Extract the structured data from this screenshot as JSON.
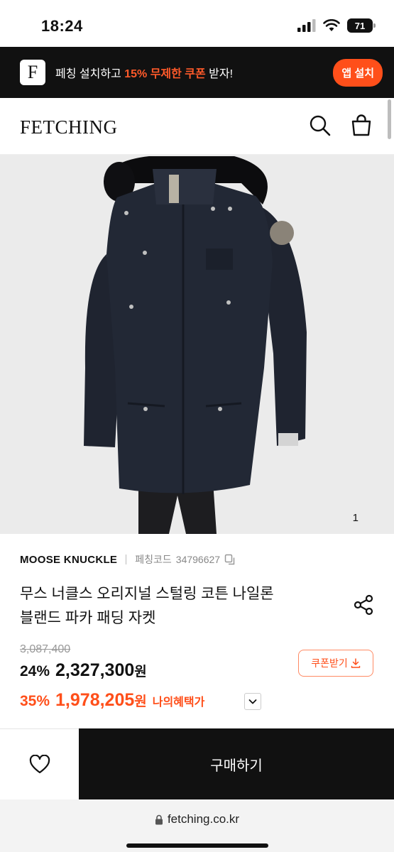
{
  "status_bar": {
    "time": "18:24",
    "battery": "71"
  },
  "app_banner": {
    "logo": "F",
    "text_prefix": "페칭 설치하고 ",
    "text_highlight": "15% 무제한 쿠폰",
    "text_suffix": " 받자!",
    "install_label": "앱 설치",
    "accent_color": "#ff4f1a"
  },
  "header": {
    "wordmark": "FETCHING",
    "icons": [
      "search-icon",
      "shopping-bag-icon"
    ]
  },
  "gallery": {
    "counter": "1"
  },
  "product": {
    "brand": "MOOSE KNUCKLE",
    "code_label": "페칭코드",
    "code": "34796627",
    "title_line1": "무스 너클스 오리지널 스털링 코튼 나일론",
    "title_line2": "블랜드 파카 패딩 자켓",
    "original_price": "3,087,400",
    "discount_pct": "24%",
    "price": "2,327,300",
    "won": "원",
    "coupon_pct": "35%",
    "coupon_price": "1,978,205",
    "my_benefit_label": "나의혜택가",
    "coupon_button_label": "쿠폰받기"
  },
  "bottom_bar": {
    "buy_label": "구매하기"
  },
  "browser": {
    "url": "fetching.co.kr"
  }
}
